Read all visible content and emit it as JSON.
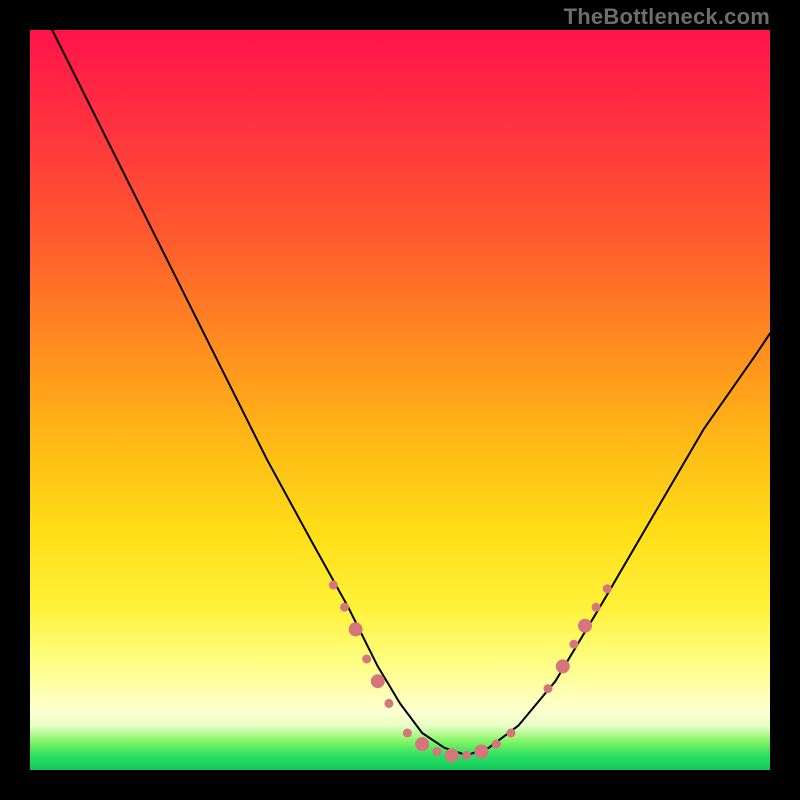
{
  "watermark": "TheBottleneck.com",
  "chart_data": {
    "type": "line",
    "title": "",
    "xlabel": "",
    "ylabel": "",
    "xlim": [
      0,
      100
    ],
    "ylim": [
      0,
      100
    ],
    "grid": false,
    "legend": false,
    "series": [
      {
        "name": "curve",
        "color": "#000000",
        "stroke_width": 2,
        "x": [
          3,
          8,
          14,
          20,
          26,
          32,
          38,
          43,
          47,
          50,
          53,
          56,
          59,
          62,
          66,
          71,
          77,
          84,
          91,
          98,
          100
        ],
        "values": [
          100,
          90,
          78,
          66,
          54,
          42,
          31,
          22,
          14,
          9,
          5,
          3,
          2,
          3,
          6,
          12,
          22,
          34,
          46,
          56,
          59
        ]
      }
    ],
    "markers": {
      "name": "highlight-dots",
      "color": "#d6757c",
      "size_small": 4.5,
      "size_large": 7,
      "points": [
        {
          "x": 41,
          "y": 25,
          "r": 4.5
        },
        {
          "x": 42.5,
          "y": 22,
          "r": 4.5
        },
        {
          "x": 44,
          "y": 19,
          "r": 7
        },
        {
          "x": 45.5,
          "y": 15,
          "r": 4.5
        },
        {
          "x": 47,
          "y": 12,
          "r": 7
        },
        {
          "x": 48.5,
          "y": 9,
          "r": 4.5
        },
        {
          "x": 51,
          "y": 5,
          "r": 4.5
        },
        {
          "x": 53,
          "y": 3.5,
          "r": 7
        },
        {
          "x": 55,
          "y": 2.5,
          "r": 4.5
        },
        {
          "x": 57,
          "y": 2,
          "r": 7
        },
        {
          "x": 59,
          "y": 2,
          "r": 4.5
        },
        {
          "x": 61,
          "y": 2.5,
          "r": 7
        },
        {
          "x": 63,
          "y": 3.5,
          "r": 4.5
        },
        {
          "x": 65,
          "y": 5,
          "r": 4.5
        },
        {
          "x": 70,
          "y": 11,
          "r": 4.5
        },
        {
          "x": 72,
          "y": 14,
          "r": 7
        },
        {
          "x": 73.5,
          "y": 17,
          "r": 4.5
        },
        {
          "x": 75,
          "y": 19.5,
          "r": 7
        },
        {
          "x": 76.5,
          "y": 22,
          "r": 4.5
        },
        {
          "x": 78,
          "y": 24.5,
          "r": 4.5
        }
      ]
    }
  }
}
